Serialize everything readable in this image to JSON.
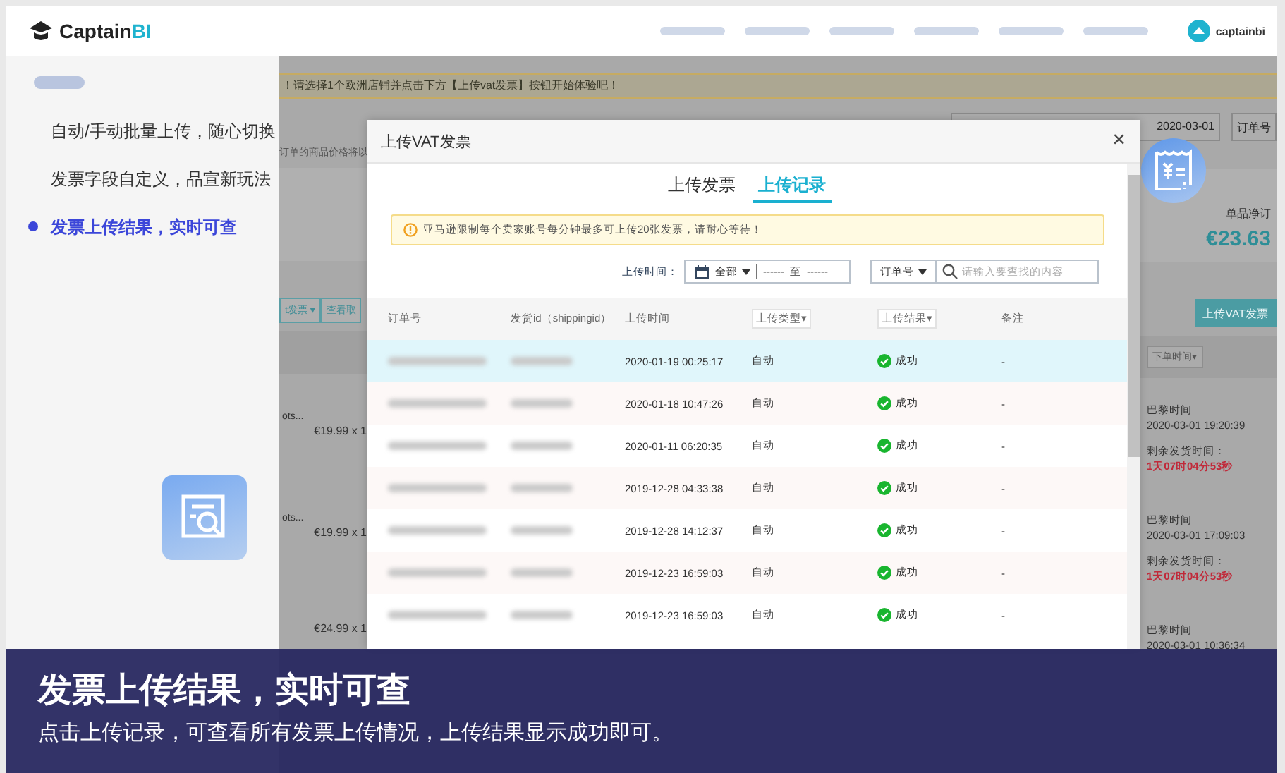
{
  "header": {
    "logo": {
      "name": "Captain",
      "suffix": "BI"
    },
    "user": "captainbi"
  },
  "feature_panel": {
    "items": [
      {
        "label": "自动/手动批量上传，随心切换",
        "selected": false
      },
      {
        "label": "发票字段自定义，品宣新玩法",
        "selected": false
      },
      {
        "label": "发票上传结果，实时可查",
        "selected": true
      }
    ]
  },
  "background_page": {
    "notice": "！请选择1个欧洲店铺并点击下方【上传vat发票】按钮开始体验吧！",
    "date": "2020-03-01",
    "order_button": "订单号",
    "note_fragment": "订单的商品价格将以",
    "stat_label": "单品净订",
    "stat_value": "€23.63",
    "upload_button": "上传VAT发票",
    "action_tabs": [
      "t发票 ▾",
      "查看取"
    ],
    "products": [
      {
        "name": "ots...",
        "price": "€19.99 x 1"
      },
      {
        "name": "ots...",
        "price": "€19.99 x 1"
      },
      {
        "price": "€24.99 x 1"
      }
    ],
    "sort_label": "下单时间▾",
    "orders": [
      {
        "zone": "巴黎时间",
        "time": "2020-03-01 19:20:39",
        "remaining_label": "剩余发货时间：",
        "remaining": "1天07时04分53秒"
      },
      {
        "zone": "巴黎时间",
        "time": "2020-03-01 17:09:03",
        "remaining_label": "剩余发货时间：",
        "remaining": "1天07时04分53秒"
      },
      {
        "zone": "巴黎时间",
        "time": "2020-03-01 10:36:34"
      }
    ]
  },
  "dialog": {
    "title": "上传VAT发票",
    "close": "×",
    "tabs": [
      {
        "label": "上传发票",
        "selected": false
      },
      {
        "label": "上传记录",
        "selected": true
      }
    ],
    "alert": "亚马逊限制每个卖家账号每分钟最多可上传20张发票，请耐心等待！",
    "filter": {
      "label": "上传时间：",
      "range_select": "全部",
      "range_start": "------",
      "range_separator": "至",
      "range_end": "------",
      "search_select": "订单号",
      "placeholder": "请输入要查找的内容"
    },
    "columns": [
      {
        "label": "订单号",
        "kind": "text"
      },
      {
        "label": "发货id（shippingid）",
        "kind": "text"
      },
      {
        "label": "上传时间",
        "kind": "text"
      },
      {
        "label": "上传类型▾",
        "kind": "filter"
      },
      {
        "label": "上传结果▾",
        "kind": "filter"
      },
      {
        "label": "备注",
        "kind": "text"
      }
    ],
    "rows": [
      {
        "time": "2020-01-19 00:25:17",
        "type": "自动",
        "result": "成功",
        "note": "-",
        "selected": true
      },
      {
        "time": "2020-01-18 10:47:26",
        "type": "自动",
        "result": "成功",
        "note": "-",
        "selected": false
      },
      {
        "time": "2020-01-11 06:20:35",
        "type": "自动",
        "result": "成功",
        "note": "-",
        "selected": false
      },
      {
        "time": "2019-12-28 04:33:38",
        "type": "自动",
        "result": "成功",
        "note": "-",
        "selected": false
      },
      {
        "time": "2019-12-28 14:12:37",
        "type": "自动",
        "result": "成功",
        "note": "-",
        "selected": false
      },
      {
        "time": "2019-12-23 16:59:03",
        "type": "自动",
        "result": "成功",
        "note": "-",
        "selected": false
      },
      {
        "time": "2019-12-23 16:59:03",
        "type": "自动",
        "result": "成功",
        "note": "-",
        "selected": false
      }
    ]
  },
  "caption": {
    "title": "发票上传结果，实时可查",
    "subtitle": "点击上传记录，可查看所有发票上传情况，上传结果显示成功即可。"
  }
}
